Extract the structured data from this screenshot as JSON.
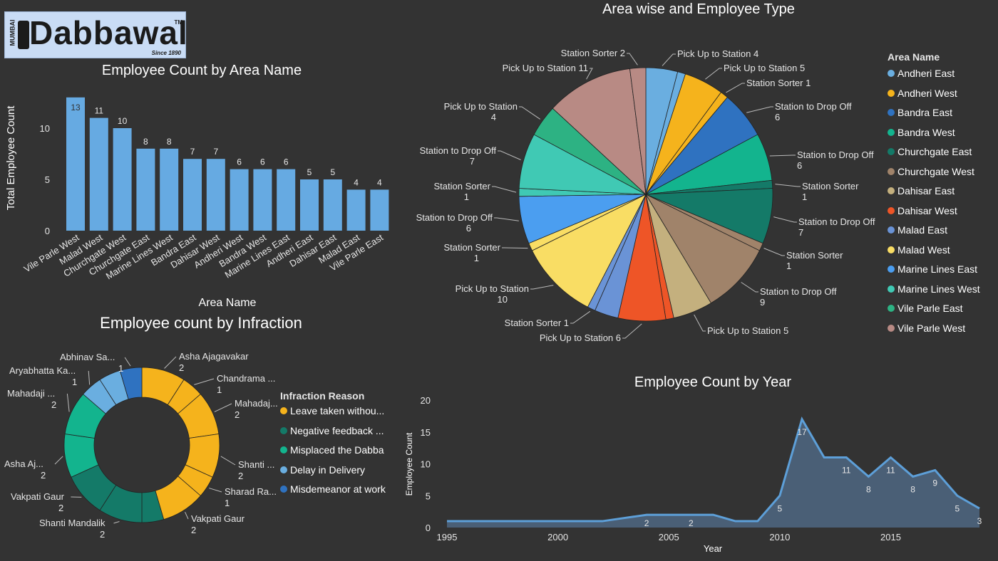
{
  "logo": {
    "side_text": "MUMBAI",
    "main_text": "Dabbawala",
    "tm": "TM",
    "since": "Since 1890",
    "color": "#1b1b1b"
  },
  "bar_chart": {
    "title": "Employee Count by Area Name",
    "xlabel": "Area Name",
    "ylabel": "Total Employee Count",
    "yticks": [
      "0",
      "5",
      "10"
    ]
  },
  "pie_chart": {
    "title": "Area wise and Employee Type"
  },
  "legend_area": {
    "title": "Area Name",
    "items": [
      {
        "label": "Andheri East",
        "color": "#6aaee0"
      },
      {
        "label": "Andheri West",
        "color": "#f5b31c"
      },
      {
        "label": "Bandra East",
        "color": "#2f72c0"
      },
      {
        "label": "Bandra West",
        "color": "#13b48e"
      },
      {
        "label": "Churchgate East",
        "color": "#147a68"
      },
      {
        "label": "Churchgate West",
        "color": "#a0836a"
      },
      {
        "label": "Dahisar East",
        "color": "#c4b07e"
      },
      {
        "label": "Dahisar West",
        "color": "#ee5527"
      },
      {
        "label": "Malad East",
        "color": "#6a93d6"
      },
      {
        "label": "Malad West",
        "color": "#f9dd64"
      },
      {
        "label": "Marine Lines East",
        "color": "#4b9ef0"
      },
      {
        "label": "Marine Lines West",
        "color": "#40c9b4"
      },
      {
        "label": "Vile Parle East",
        "color": "#2db283"
      },
      {
        "label": "Vile Parle West",
        "color": "#b88a84"
      }
    ]
  },
  "donut_chart": {
    "title": "Employee count by Infraction"
  },
  "legend_infraction": {
    "title": "Infraction Reason",
    "items": [
      {
        "label": "Leave taken withou...",
        "color": "#f5b31c"
      },
      {
        "label": "Negative feedback ...",
        "color": "#147a68"
      },
      {
        "label": "Misplaced the Dabba",
        "color": "#13b48e"
      },
      {
        "label": "Delay in Delivery",
        "color": "#6aaee0"
      },
      {
        "label": "Misdemeanor at work",
        "color": "#2f72c0"
      }
    ]
  },
  "area_chart": {
    "title": "Employee Count by Year",
    "xlabel": "Year",
    "ylabel": "Employee Count",
    "yticks": [
      "0",
      "5",
      "10",
      "15",
      "20"
    ],
    "xticks": [
      "1995",
      "2000",
      "2005",
      "2010",
      "2015"
    ]
  },
  "chart_data": [
    {
      "type": "bar",
      "title": "Employee Count by Area Name",
      "xlabel": "Area Name",
      "ylabel": "Total Employee Count",
      "ylim": [
        0,
        14
      ],
      "color": "#66aae2",
      "categories": [
        "Vile Parle West",
        "Malad West",
        "Churchgate West",
        "Churchgate East",
        "Marine Lines West",
        "Bandra East",
        "Dahisar West",
        "Andheri West",
        "Bandra West",
        "Marine Lines East",
        "Andheri East",
        "Dahisar East",
        "Malad East",
        "Vile Parle East"
      ],
      "values": [
        13,
        11,
        10,
        8,
        8,
        7,
        7,
        6,
        6,
        6,
        5,
        5,
        4,
        4
      ]
    },
    {
      "type": "pie",
      "title": "Area wise and Employee Type",
      "slices": [
        {
          "name": "Pick Up to Station",
          "label": "Pick Up to Station 4",
          "value": 4,
          "area": "Andheri East",
          "color": "#6aaee0",
          "split": false
        },
        {
          "name": "Station Sorter",
          "label": "",
          "value": 1,
          "area": "Andheri East",
          "color": "#6aaee0",
          "split": false
        },
        {
          "name": "Pick Up to Station",
          "label": "Pick Up to Station 5",
          "value": 5,
          "area": "Andheri West",
          "color": "#f5b31c",
          "split": false
        },
        {
          "name": "Station Sorter",
          "label": "Station Sorter 1",
          "value": 1,
          "area": "Andheri West",
          "color": "#f5b31c",
          "split": false
        },
        {
          "name": "Station to Drop Off",
          "label": "Station to Drop Off",
          "label2": "6",
          "value": 6,
          "area": "Bandra East",
          "color": "#2f72c0",
          "split": false
        },
        {
          "name": "Station to Drop Off",
          "label": "Station to Drop Off",
          "label2": "6",
          "value": 6,
          "area": "Bandra West",
          "color": "#13b48e",
          "split": false
        },
        {
          "name": "Station Sorter",
          "label": "Station Sorter",
          "label2": "1",
          "value": 1,
          "area": "Churchgate East",
          "color": "#147a68",
          "split": false
        },
        {
          "name": "Station to Drop Off",
          "label": "Station to Drop Off",
          "label2": "7",
          "value": 7,
          "area": "Churchgate East",
          "color": "#147a68",
          "split": false
        },
        {
          "name": "Station Sorter",
          "label": "Station Sorter",
          "label2": "1",
          "value": 1,
          "area": "Churchgate West",
          "color": "#a0836a",
          "split": false
        },
        {
          "name": "Station to Drop Off",
          "label": "Station to Drop Off",
          "label2": "9",
          "value": 9,
          "area": "Churchgate West",
          "color": "#a0836a",
          "split": false
        },
        {
          "name": "Pick Up to Station",
          "label": "Pick Up to Station 5",
          "value": 5,
          "area": "Dahisar East",
          "color": "#c4b07e",
          "split": false
        },
        {
          "name": "Station Sorter",
          "label": "",
          "value": 1,
          "area": "Dahisar West",
          "color": "#ee5527",
          "split": false
        },
        {
          "name": "Pick Up to Station",
          "label": "Pick Up to Station 6",
          "value": 6,
          "area": "Dahisar West",
          "color": "#ee5527",
          "split": false
        },
        {
          "name": "Station to Drop Off",
          "label": "",
          "value": 3,
          "area": "Malad East",
          "color": "#6a93d6",
          "split": false
        },
        {
          "name": "Station Sorter",
          "label": "Station Sorter 1",
          "value": 1,
          "area": "Malad East",
          "color": "#6a93d6",
          "split": false
        },
        {
          "name": "Pick Up to Station",
          "label": "Pick Up to Station",
          "label2": "10",
          "value": 10,
          "area": "Malad West",
          "color": "#f9dd64",
          "split": false
        },
        {
          "name": "Station Sorter",
          "label": "Station Sorter",
          "label2": "1",
          "value": 1,
          "area": "Malad West",
          "color": "#f9dd64",
          "split": false
        },
        {
          "name": "Station to Drop Off",
          "label": "Station to Drop Off",
          "label2": "6",
          "value": 6,
          "area": "Marine Lines East",
          "color": "#4b9ef0",
          "split": false
        },
        {
          "name": "Station Sorter",
          "label": "Station Sorter",
          "label2": "1",
          "value": 1,
          "area": "Marine Lines West",
          "color": "#40c9b4",
          "split": false
        },
        {
          "name": "Station to Drop Off",
          "label": "Station to Drop Off",
          "label2": "7",
          "value": 7,
          "area": "Marine Lines West",
          "color": "#40c9b4",
          "split": false
        },
        {
          "name": "Pick Up to Station",
          "label": "Pick Up to Station",
          "label2": "4",
          "value": 4,
          "area": "Vile Parle East",
          "color": "#2db283",
          "split": false
        },
        {
          "name": "Pick Up to Station",
          "label": "Pick Up to Station 11",
          "value": 11,
          "area": "Vile Parle West",
          "color": "#b88a84",
          "split": false
        },
        {
          "name": "Station Sorter",
          "label": "Station Sorter 2",
          "value": 2,
          "area": "Vile Parle West",
          "color": "#b88a84",
          "split": false
        }
      ]
    },
    {
      "type": "pie",
      "subtype": "donut",
      "title": "Employee count by Infraction",
      "slices": [
        {
          "label": "Asha Ajagavakar",
          "value": 2,
          "reason": "Leave taken withou...",
          "color": "#f5b31c"
        },
        {
          "label": "Chandrama ...",
          "value": 1,
          "reason": "Leave taken withou...",
          "color": "#f5b31c"
        },
        {
          "label": "Mahadaj...",
          "value": 2,
          "reason": "Leave taken withou...",
          "color": "#f5b31c"
        },
        {
          "label": "Shanti ...",
          "value": 2,
          "reason": "Leave taken withou...",
          "color": "#f5b31c"
        },
        {
          "label": "Sharad Ra...",
          "value": 1,
          "reason": "Leave taken withou...",
          "color": "#f5b31c"
        },
        {
          "label": "Vakpati Gaur",
          "value": 2,
          "reason": "Leave taken withou...",
          "color": "#f5b31c"
        },
        {
          "label": "",
          "value": 1,
          "reason": "Negative feedback ...",
          "color": "#147a68"
        },
        {
          "label": "Shanti Mandalik",
          "value": 2,
          "reason": "Negative feedback ...",
          "color": "#147a68"
        },
        {
          "label": "Vakpati Gaur",
          "value": 2,
          "reason": "Negative feedback ...",
          "color": "#147a68"
        },
        {
          "label": "Asha Aj...",
          "value": 2,
          "reason": "Misplaced the Dabba",
          "color": "#13b48e"
        },
        {
          "label": "Mahadaji ...",
          "value": 2,
          "reason": "Misplaced the Dabba",
          "color": "#13b48e"
        },
        {
          "label": "Aryabhatta Ka...",
          "value": 1,
          "reason": "Delay in Delivery",
          "color": "#6aaee0"
        },
        {
          "label": "",
          "value": 1,
          "reason": "Delay in Delivery",
          "color": "#6aaee0"
        },
        {
          "label": "Abhinav Sa...",
          "value": 1,
          "reason": "Misdemeanor at work",
          "color": "#2f72c0"
        }
      ]
    },
    {
      "type": "area",
      "title": "Employee Count by Year",
      "xlabel": "Year",
      "ylabel": "Employee Count",
      "xlim": [
        1995,
        2019
      ],
      "ylim": [
        0,
        20
      ],
      "color": "#5d9fd8",
      "x": [
        1995,
        1996,
        1997,
        1998,
        1999,
        2000,
        2001,
        2002,
        2003,
        2004,
        2005,
        2006,
        2007,
        2008,
        2009,
        2010,
        2011,
        2012,
        2013,
        2014,
        2015,
        2016,
        2017,
        2018,
        2019
      ],
      "y": [
        1,
        1,
        1,
        1,
        1,
        1,
        1,
        1,
        1.5,
        2,
        2,
        2,
        2,
        1,
        1,
        5,
        17,
        11,
        11,
        8,
        11,
        8,
        9,
        5,
        3
      ],
      "point_labels": [
        {
          "x": 2004,
          "text": "2"
        },
        {
          "x": 2006,
          "text": "2"
        },
        {
          "x": 2010,
          "text": "5"
        },
        {
          "x": 2011,
          "text": "17"
        },
        {
          "x": 2013,
          "text": "11"
        },
        {
          "x": 2014,
          "text": "8"
        },
        {
          "x": 2015,
          "text": "11"
        },
        {
          "x": 2016,
          "text": "8"
        },
        {
          "x": 2017,
          "text": "9"
        },
        {
          "x": 2018,
          "text": "5"
        },
        {
          "x": 2019,
          "text": "3"
        }
      ]
    }
  ]
}
